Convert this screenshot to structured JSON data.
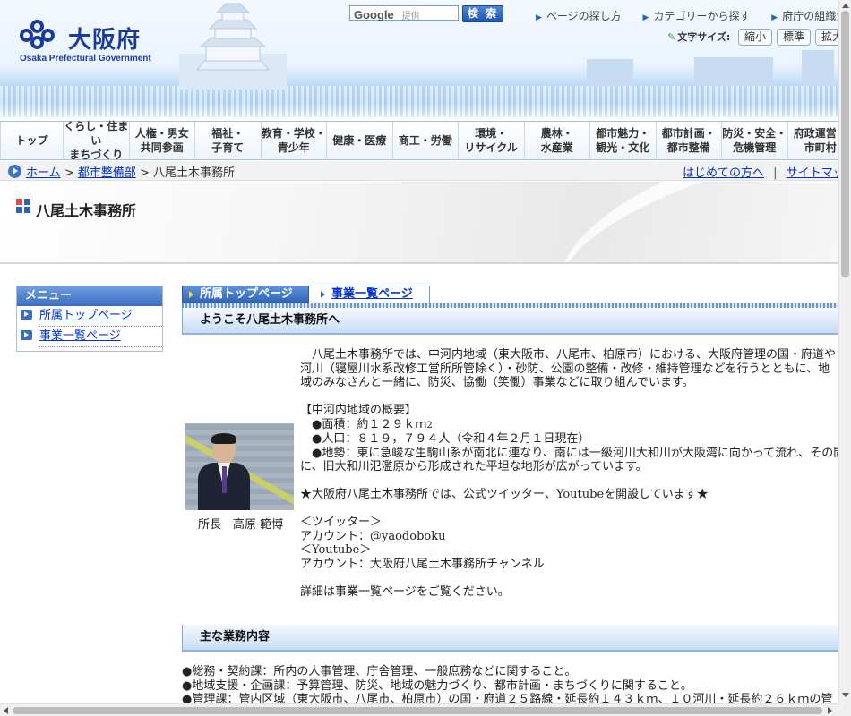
{
  "header": {
    "logo_title": "大阪府",
    "logo_sub": "Osaka Prefectural Government",
    "search_brand": "Google",
    "search_provided": "提供",
    "search_button": "検 索",
    "top_links": [
      "ページの探し方",
      "カテゴリーから探す",
      "府庁の組織から探す"
    ],
    "font_size_label": "文字サイズ:",
    "font_buttons": [
      "縮小",
      "標準",
      "拡大"
    ]
  },
  "gnav": [
    [
      "トップ"
    ],
    [
      "くらし・住まい",
      "まちづくり"
    ],
    [
      "人権・男女",
      "共同参画"
    ],
    [
      "福祉・",
      "子育て"
    ],
    [
      "教育・学校・",
      "青少年"
    ],
    [
      "健康・医療"
    ],
    [
      "商工・労働"
    ],
    [
      "環境・",
      "リサイクル"
    ],
    [
      "農林・",
      "水産業"
    ],
    [
      "都市魅力・",
      "観光・文化"
    ],
    [
      "都市計画・",
      "都市整備"
    ],
    [
      "防災・安全・",
      "危機管理"
    ],
    [
      "府政運営・",
      "市町村"
    ]
  ],
  "breadcrumb": {
    "home": "ホーム",
    "sep": ">",
    "parent": "都市整備部",
    "current": "八尾土木事務所",
    "first_time": "はじめての方へ",
    "divider": "|",
    "sitemap": "サイトマップ"
  },
  "page_title": "八尾土木事務所",
  "menu": {
    "title": "メニュー",
    "items": [
      "所属トップページ",
      "事業一覧ページ"
    ]
  },
  "tabs": [
    "所属トップページ",
    "事業一覧ページ"
  ],
  "welcome_heading": "ようこそ八尾土木事務所へ",
  "intro": {
    "lines": [
      "　八尾土木事務所では、中河内地域（東大阪市、八尾市、柏原市）における、大阪府管理の国・府道や",
      "河川（寝屋川水系改修工営所所管除く）・砂防、公園の整備・改修・維持管理などを行うとともに、地",
      "域のみなさんと一緒に、防災、協働（笑働）事業などに取り組んでいます。"
    ],
    "overview_heading": "【中河内地域の概要】",
    "area": "　●面積：約１２９ｋｍ",
    "area_sup": "2",
    "population": "　●人口：８１９，７９４人（令和４年２月１日現在）",
    "terrain_1": "　●地勢：東に急峻な生駒山系が南北に連なり、南には一級河川大和川が大阪湾に向かって流れ、その間",
    "terrain_2": "に、旧大和川氾濫原から形成された平坦な地形が広がっています。",
    "sns_notice": "★大阪府八尾土木事務所では、公式ツイッター、Youtubeを開設しています★",
    "twitter_label": "＜ツイッター＞",
    "twitter_account": "アカウント：@yaodoboku",
    "youtube_label": "＜Youtube＞",
    "youtube_account": "アカウント：大阪府八尾土木事務所チャンネル",
    "details": "詳細は事業一覧ページをご覧ください。"
  },
  "portrait_caption": "所長　高原 範博",
  "duties_heading": "主な業務内容",
  "duties": [
    "●総務・契約課：所内の人事管理、庁舎管理、一般庶務などに関すること。",
    "●地域支援・企画課：予算管理、防災、地域の魅力づくり、都市計画・まちづくりに関すること。",
    "●管理課：管内区域（東大阪市、八尾市、柏原市）の国・府道２５路線・延長約１４３ｋｍ、１０河川・延長約２６ｋｍの管"
  ],
  "colors": {
    "brand": "#1a3a9c",
    "link": "#0033cc",
    "accent": "#3a6dc0"
  }
}
